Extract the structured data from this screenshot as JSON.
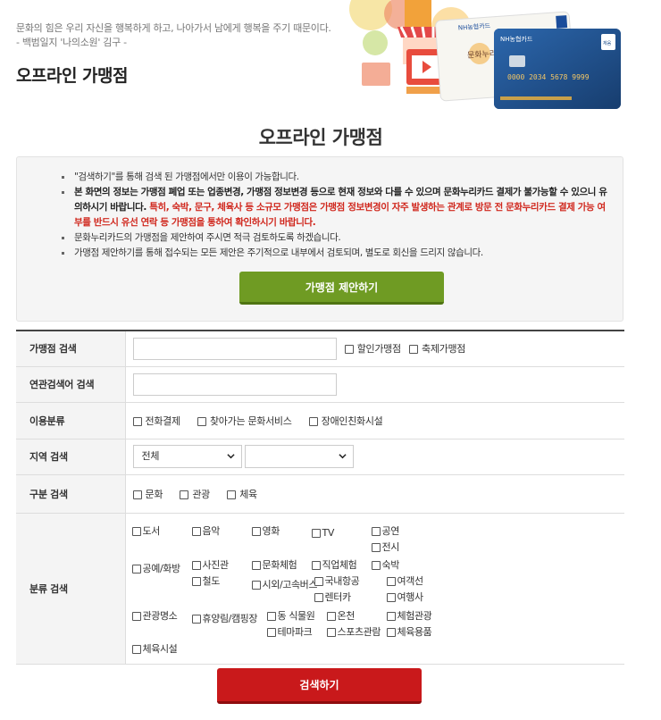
{
  "header": {
    "quote_line1": "문화의 힘은 우리 자신을 행복하게 하고, 나아가서 남에게 행복을 주기 때문이다.",
    "quote_line2": "- 백범일지 '나의소원' 김구 -",
    "page_title": "오프라인 가맹점"
  },
  "banner": {
    "card_brand": "NH농협카드",
    "card_name": "문화누리",
    "card_number": "0000 2034 5678 9999",
    "card_badge": "체움"
  },
  "section_title": "오프라인 가맹점",
  "notice": {
    "items": [
      {
        "text": "\"검색하기\"를 통해 검색 된 가맹점에서만 이용이 가능합니다."
      },
      {
        "text": "본 화면의 정보는 가맹점 폐업 또는 업종변경, 가맹점 정보변경 등으로 현재 정보와 다를 수 있으며 문화누리카드 결제가 불가능할 수 있으니 유의하시기 바랍니다. ",
        "red": "특히, 숙박, 문구, 체육사 등 소규모 가맹점은 가맹점 정보변경이 자주 발생하는 관계로 방문 전 문화누리카드 결제 가능 여부를 반드시 유선 연락 등 가맹점을 통하여 확인하시기 바랍니다."
      },
      {
        "text": "문화누리카드의 가맹점을 제안하여 주시면 적극 검토하도록 하겠습니다."
      },
      {
        "text": "가맹점 제안하기를 통해 접수되는 모든 제안은 주기적으로 내부에서 검토되며, 별도로 회신을 드리지 않습니다."
      }
    ],
    "suggest_button": "가맹점 제안하기"
  },
  "form": {
    "merchant_search": {
      "label": "가맹점 검색",
      "value": "",
      "discount": "할인가맹점",
      "festival": "축제가맹점"
    },
    "related_search": {
      "label": "연관검색어 검색",
      "value": ""
    },
    "usage": {
      "label": "이용분류",
      "options": [
        "전화결제",
        "찾아가는 문화서비스",
        "장애인친화시설"
      ]
    },
    "region": {
      "label": "지역 검색",
      "select1": "전체",
      "select2": ""
    },
    "division": {
      "label": "구분 검색",
      "options": [
        "문화",
        "관광",
        "체육"
      ]
    },
    "category": {
      "label": "분류 검색",
      "items": [
        "도서",
        "음악",
        "영화",
        "TV",
        "공연",
        "전시",
        "공예/화방",
        "사진관",
        "문화체험",
        "직업체험",
        "숙박",
        "철도",
        "시외/고속버스",
        "국내항공",
        "여객선",
        "렌터카",
        "여행사",
        "관광명소",
        "휴양림/캠핑장",
        "동 식물원",
        "온천",
        "체험관광",
        "테마파크",
        "스포츠관람",
        "체육용품",
        "체육시설"
      ]
    }
  },
  "search_button": "검색하기",
  "colors": {
    "suggest": "#6f9b23",
    "search": "#c9191b",
    "notice_red": "#d0271d"
  }
}
